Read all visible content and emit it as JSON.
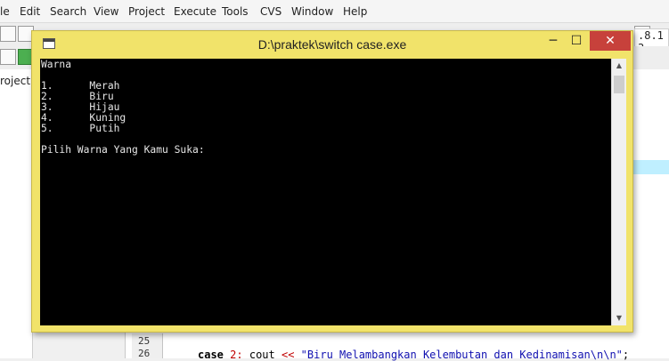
{
  "ide": {
    "menu": [
      "le",
      "Edit",
      "Search",
      "View",
      "Project",
      "Execute",
      "Tools",
      "CVS",
      "Window",
      "Help"
    ],
    "version_text": ".8.1 3",
    "project_label": "roject",
    "line_numbers": [
      "25",
      "26"
    ],
    "code_line": {
      "keyword": "case",
      "number": "2",
      "colon": ":",
      "stream": "cout",
      "operator": "<<",
      "string": "\"Biru Melambangkan Kelembutan dan Kedinamisan\\n\\n\"",
      "semicolon": ";"
    }
  },
  "console": {
    "title": "D:\\praktek\\switch case.exe",
    "minimize": "─",
    "maximize": "☐",
    "close": "✕",
    "output": "Warna\n\n1.      Merah\n2.      Biru\n3.      Hijau\n4.      Kuning\n5.      Putih\n\nPilih Warna Yang Kamu Suka:"
  },
  "colors": {
    "console_frame": "#f1e36a",
    "console_bg": "#000000",
    "close_button": "#c7413b"
  }
}
